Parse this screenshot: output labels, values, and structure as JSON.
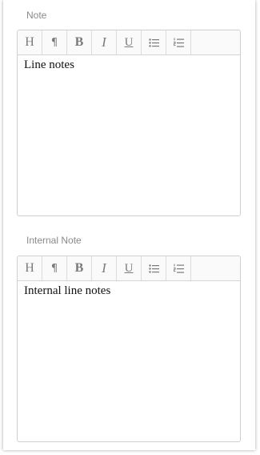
{
  "note": {
    "label": "Note",
    "content": "Line notes"
  },
  "internal_note": {
    "label": "Internal Note",
    "content": "Internal line notes"
  },
  "toolbar": {
    "heading": "H",
    "paragraph": "¶",
    "bold": "B",
    "italic": "I",
    "underline": "U",
    "icons": [
      "heading-icon",
      "paragraph-icon",
      "bold-icon",
      "italic-icon",
      "underline-icon",
      "bulleted-list-icon",
      "numbered-list-icon"
    ]
  },
  "colors": {
    "label": "#8a8a8a",
    "border": "#cfcfcf",
    "icon": "#7a7a7a",
    "text": "#111111"
  }
}
